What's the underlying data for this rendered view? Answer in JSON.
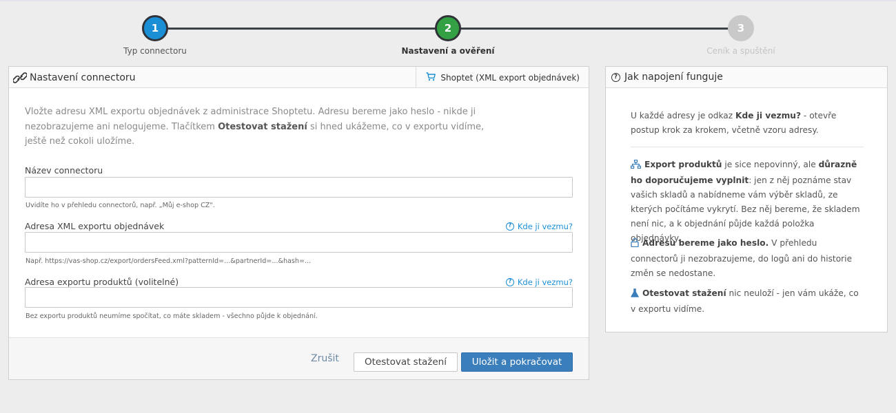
{
  "stepper": {
    "steps": [
      {
        "number": "1",
        "label": "Typ connectoru",
        "state": "done"
      },
      {
        "number": "2",
        "label": "Nastavení a ověření",
        "state": "active"
      },
      {
        "number": "3",
        "label": "Ceník a spuštění",
        "state": "pending"
      }
    ]
  },
  "main_panel": {
    "title": "Nastavení connectoru",
    "title_icon": "link-icon",
    "source_tag": {
      "icon": "cart-icon",
      "label": "Shoptet (XML export objednávek)"
    },
    "intro": {
      "part1": "Vložte adresu XML exportu objednávek z administrace Shoptetu. Adresu bereme jako heslo - nikde ji nezobrazujeme ani nelogujeme. Tlačítkem ",
      "bold": "Otestovat stažení",
      "part2": " si hned ukážeme, co v exportu vidíme, ještě než cokoli uložíme."
    },
    "fields": [
      {
        "label": "Název connectoru",
        "value": "",
        "hint": "Uvidíte ho v přehledu connectorů, např. „Můj e-shop CZ\".",
        "help_link": ""
      },
      {
        "label": "Adresa XML exportu objednávek",
        "value": "",
        "hint": "Např. https://vas-shop.cz/export/ordersFeed.xml?patternId=...&partnerId=...&hash=...",
        "help_link": "Kde ji vezmu?"
      },
      {
        "label": "Adresa exportu produktů (volitelné)",
        "value": "",
        "hint": "Bez exportu produktů neumíme spočítat, co máte skladem - všechno půjde k objednání.",
        "help_link": "Kde ji vezmu?"
      }
    ],
    "buttons": {
      "cancel": "Zrušit",
      "test": "Otestovat stažení",
      "save": "Uložit a pokračovat"
    }
  },
  "side_panel": {
    "title": "Jak napojení funguje",
    "title_icon": "question-circle-icon",
    "intro": {
      "part1": "U každé adresy je odkaz ",
      "bold": "Kde ji vezmu?",
      "part2": " - otevře postup krok za krokem, včetně vzoru adresy."
    },
    "items": [
      {
        "icon": "sitemap-icon",
        "bold1": "Export produktů",
        "text1": " je sice nepovinný, ale ",
        "bold2": "důrazně ho doporučujeme vyplnit",
        "text2": ": jen z něj poznáme stav vašich skladů a nabídneme vám výběr skladů, ze kterých počítáme vykrytí. Bez něj bereme, že skladem není nic, a k objednání půjde každá položka objednávky."
      },
      {
        "icon": "lock-icon",
        "bold1": "Adresu bereme jako heslo.",
        "text1": " V přehledu connectorů ji nezobrazujeme, do logů ani do historie změn se nedostane.",
        "bold2": "",
        "text2": ""
      },
      {
        "icon": "flask-icon",
        "bold1": "Otestovat stažení",
        "text1": " nic neuloží - jen vám ukáže, co v exportu vidíme.",
        "bold2": "",
        "text2": ""
      }
    ]
  },
  "colors": {
    "step_done": "#1b8fd6",
    "step_active": "#33a043",
    "step_pending": "#c9c9c9",
    "primary_button": "#3b7ebc",
    "link": "#1b8fd6"
  }
}
